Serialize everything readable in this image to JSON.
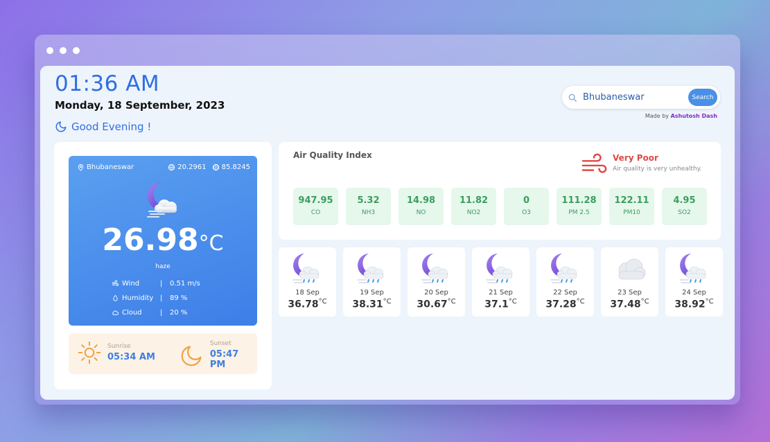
{
  "header": {
    "time": "01:36 AM",
    "date": "Monday, 18 September, 2023",
    "greeting": "Good Evening !"
  },
  "search": {
    "value": "Bhubaneswar",
    "button_label": "Search",
    "credit_prefix": "Made by",
    "credit_name": "Ashutosh Dash"
  },
  "current": {
    "location": "Bhubaneswar",
    "lat": "20.2961",
    "lon": "85.8245",
    "temperature": "26.98",
    "unit": "°C",
    "description": "haze",
    "stats": [
      {
        "label": "Wind",
        "sep": "|",
        "value": "0.51 m/s"
      },
      {
        "label": "Humidity",
        "sep": "|",
        "value": "89 %"
      },
      {
        "label": "Cloud",
        "sep": "|",
        "value": "20 %"
      }
    ]
  },
  "sun": {
    "sunrise_label": "Sunrise",
    "sunrise": "05:34 AM",
    "sunset_label": "Sunset",
    "sunset": "05:47 PM"
  },
  "aqi": {
    "title": "Air Quality Index",
    "status": "Very Poor",
    "status_desc": "Air quality is very unhealthy.",
    "status_color": "#e04848",
    "items": [
      {
        "value": "947.95",
        "name": "CO"
      },
      {
        "value": "5.32",
        "name": "NH3"
      },
      {
        "value": "14.98",
        "name": "NO"
      },
      {
        "value": "11.82",
        "name": "NO2"
      },
      {
        "value": "0",
        "name": "O3"
      },
      {
        "value": "111.28",
        "name": "PM 2.5"
      },
      {
        "value": "122.11",
        "name": "PM10"
      },
      {
        "value": "4.95",
        "name": "SO2"
      }
    ]
  },
  "forecast": [
    {
      "date": "18 Sep",
      "temp": "36.78",
      "unit": "°C",
      "icon": "moon-rain-cloud-icon"
    },
    {
      "date": "19 Sep",
      "temp": "38.31",
      "unit": "°C",
      "icon": "moon-rain-cloud-icon"
    },
    {
      "date": "20 Sep",
      "temp": "30.67",
      "unit": "°C",
      "icon": "moon-rain-cloud-icon"
    },
    {
      "date": "21 Sep",
      "temp": "37.1",
      "unit": "°C",
      "icon": "moon-rain-cloud-icon"
    },
    {
      "date": "22 Sep",
      "temp": "37.28",
      "unit": "°C",
      "icon": "moon-rain-cloud-icon"
    },
    {
      "date": "23 Sep",
      "temp": "37.48",
      "unit": "°C",
      "icon": "cloud-icon"
    },
    {
      "date": "24 Sep",
      "temp": "38.92",
      "unit": "°C",
      "icon": "moon-rain-cloud-icon"
    }
  ],
  "colors": {
    "accent": "#2f6fe0",
    "aqi_good": "#3a9e5c",
    "aqi_bad": "#e04848",
    "credit": "#7b2fc8"
  }
}
